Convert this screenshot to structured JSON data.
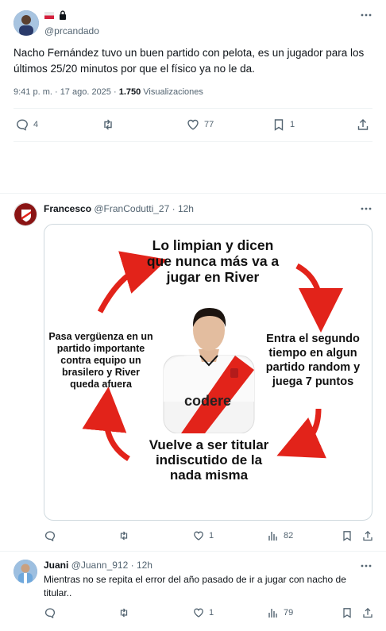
{
  "main_tweet": {
    "handle": "@prcandado",
    "text": "Nacho Fernández tuvo un buen partido con pelota, es un jugador para los últimos 25/20 minutos por que el físico ya no le da.",
    "time": "9:41 p. m. · 17 ago. 2025 · ",
    "views_count": "1.750",
    "views_label": " Visualizaciones",
    "replies": "4",
    "likes": "77",
    "bookmarks": "1"
  },
  "reply1": {
    "name": "Francesco",
    "handle": "@FranCodutti_27",
    "time": "· 12h",
    "meme": {
      "top": "Lo limpian y dicen que nunca más va a jugar en River",
      "right": "Entra el segundo tiempo en algun partido random y juega 7 puntos",
      "bottom": "Vuelve a ser titular indiscutido de la nada misma",
      "left": "Pasa vergüenza en un partido importante contra equipo un brasilero y River queda afuera",
      "jersey_brand": "codere",
      "accent": "#e2231a"
    },
    "likes": "1",
    "views": "82"
  },
  "reply2": {
    "name": "Juani",
    "handle": "@Juann_912",
    "time": "· 12h",
    "text": "Mientras no se repita el error del año pasado de ir a jugar con nacho de titular..",
    "likes": "1",
    "views": "79"
  }
}
